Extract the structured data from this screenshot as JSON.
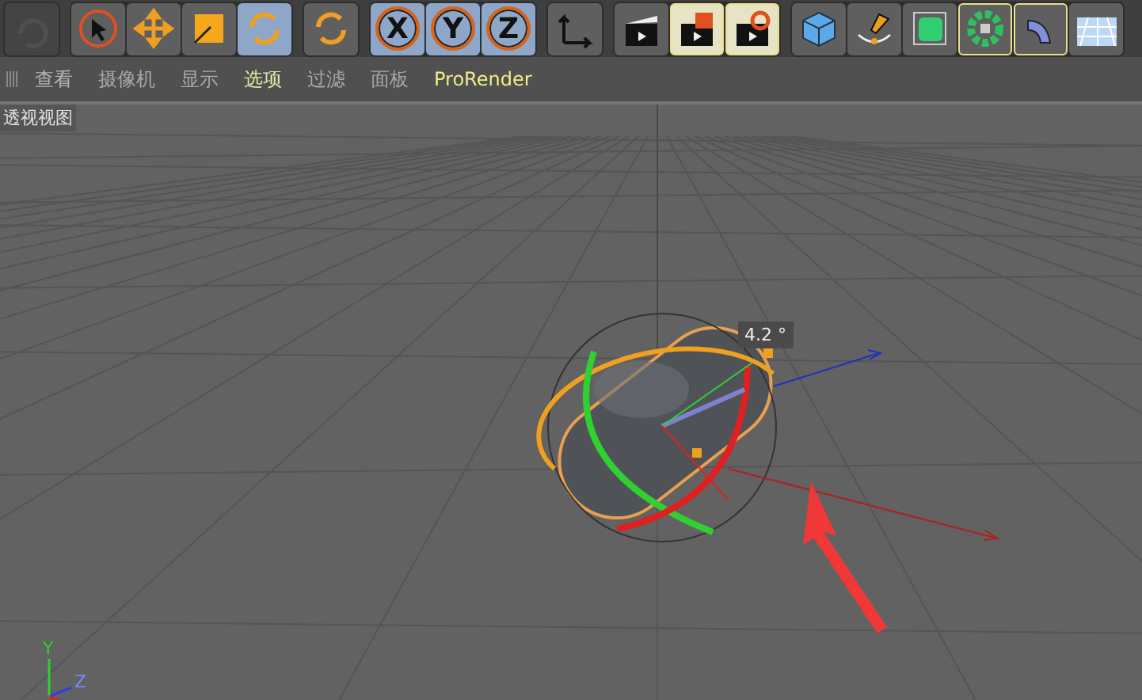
{
  "toolbar": {
    "groups": [
      {
        "buttons": [
          {
            "selected": false,
            "disabled": true
          }
        ]
      },
      {
        "buttons": [
          {
            "selected": false,
            "disabled": false
          },
          {
            "selected": false,
            "disabled": false
          },
          {
            "selected": false,
            "disabled": false
          },
          {
            "selected": true,
            "disabled": false
          }
        ]
      },
      {
        "buttons": [
          {
            "selected": false,
            "disabled": false
          }
        ]
      },
      {
        "buttons": [
          {
            "label": "X",
            "selected": true,
            "disabled": false
          },
          {
            "label": "Y",
            "selected": true,
            "disabled": false
          },
          {
            "label": "Z",
            "selected": true,
            "disabled": false
          }
        ]
      },
      {
        "buttons": [
          {
            "selected": false,
            "disabled": false
          }
        ]
      },
      {
        "buttons": [
          {
            "selected": false,
            "disabled": false
          },
          {
            "selected": true,
            "disabled": false
          },
          {
            "selected": true,
            "disabled": false
          }
        ]
      },
      {
        "buttons": [
          {
            "selected": false,
            "disabled": false
          },
          {
            "selected": false,
            "disabled": false
          },
          {
            "selected": false,
            "disabled": false
          },
          {
            "selected": true,
            "disabled": false
          },
          {
            "selected": true,
            "disabled": false
          },
          {
            "selected": false,
            "disabled": false
          }
        ]
      }
    ]
  },
  "menu": [
    {
      "label": "查看",
      "color": "#b4b4b4"
    },
    {
      "label": "摄像机",
      "color": "#a8a8a8"
    },
    {
      "label": "显示",
      "color": "#a8a8a8"
    },
    {
      "label": "选项",
      "color": "#e6e6a6"
    },
    {
      "label": "过滤",
      "color": "#a8a8a8"
    },
    {
      "label": "面板",
      "color": "#a8a8a8"
    },
    {
      "label": "ProRender",
      "color": "#eeee88"
    }
  ],
  "viewport": {
    "title": "透视视图",
    "angle_readout": "4.2 °",
    "axis_labels": [
      "Y",
      "Z"
    ]
  }
}
